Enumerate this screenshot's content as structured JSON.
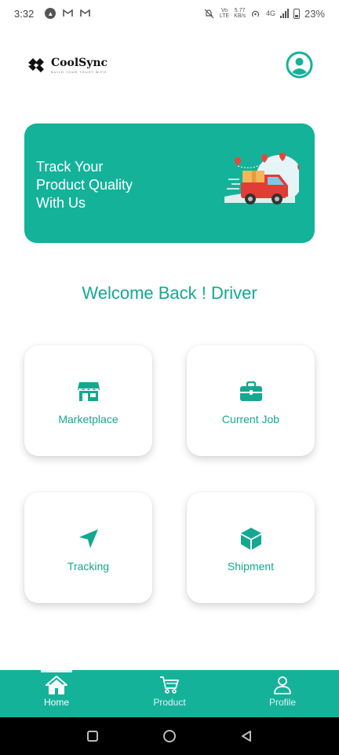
{
  "status_bar": {
    "time": "3:32",
    "net_speed_value": "5.77",
    "net_speed_unit": "KB/s",
    "network": "4G",
    "battery": "23%"
  },
  "header": {
    "app_name": "CoolSync",
    "tagline": "BUILD YOUR TRUST WITH"
  },
  "banner": {
    "lines": [
      "Track Your",
      "Product Quality",
      "With Us"
    ]
  },
  "welcome": "Welcome Back ! Driver",
  "cards": [
    {
      "label": "Marketplace",
      "icon": "store-icon"
    },
    {
      "label": "Current Job",
      "icon": "briefcase-icon"
    },
    {
      "label": "Tracking",
      "icon": "navigation-arrow-icon"
    },
    {
      "label": "Shipment",
      "icon": "box-icon"
    }
  ],
  "bottom_nav": {
    "items": [
      {
        "label": "Home",
        "icon": "home-icon",
        "active": true
      },
      {
        "label": "Product",
        "icon": "cart-icon",
        "active": false
      },
      {
        "label": "Profile",
        "icon": "person-icon",
        "active": false
      }
    ]
  },
  "colors": {
    "primary": "#15b29a",
    "text_accent": "#15a891",
    "white": "#ffffff"
  }
}
